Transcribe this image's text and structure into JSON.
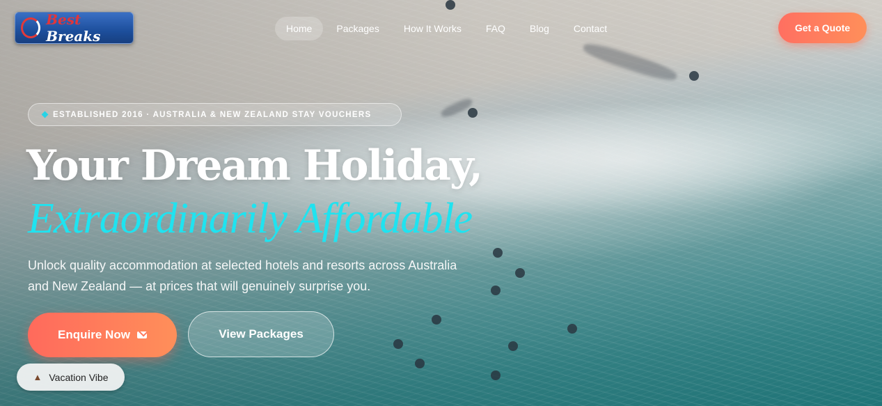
{
  "brand": {
    "logo_word1": "Best",
    "logo_word2": "Breaks"
  },
  "nav": {
    "items": [
      {
        "label": "Home",
        "active": true
      },
      {
        "label": "Packages"
      },
      {
        "label": "How It Works"
      },
      {
        "label": "FAQ"
      },
      {
        "label": "Blog"
      },
      {
        "label": "Contact"
      }
    ],
    "cta": "Get a Quote"
  },
  "hero": {
    "badge": "ESTABLISHED 2016 · AUSTRALIA & NEW ZEALAND STAY VOUCHERS",
    "title_line1": "Your Dream Holiday,",
    "title_line2": "Extraordinarily Affordable",
    "subtitle": "Unlock quality accommodation at selected hotels and resorts across Australia and New Zealand — at prices that will genuinely surprise you.",
    "primary_button": "Enquire Now",
    "secondary_button": "View Packages"
  },
  "floating_chip": {
    "label": "Vacation Vibe"
  },
  "colors": {
    "accent": "#ff7a5c",
    "highlight": "#1fe3f0"
  },
  "icons": {
    "button_icon": "mail-icon",
    "chip_icon": "palm-tree-icon",
    "badge_icon": "diamond-icon"
  }
}
